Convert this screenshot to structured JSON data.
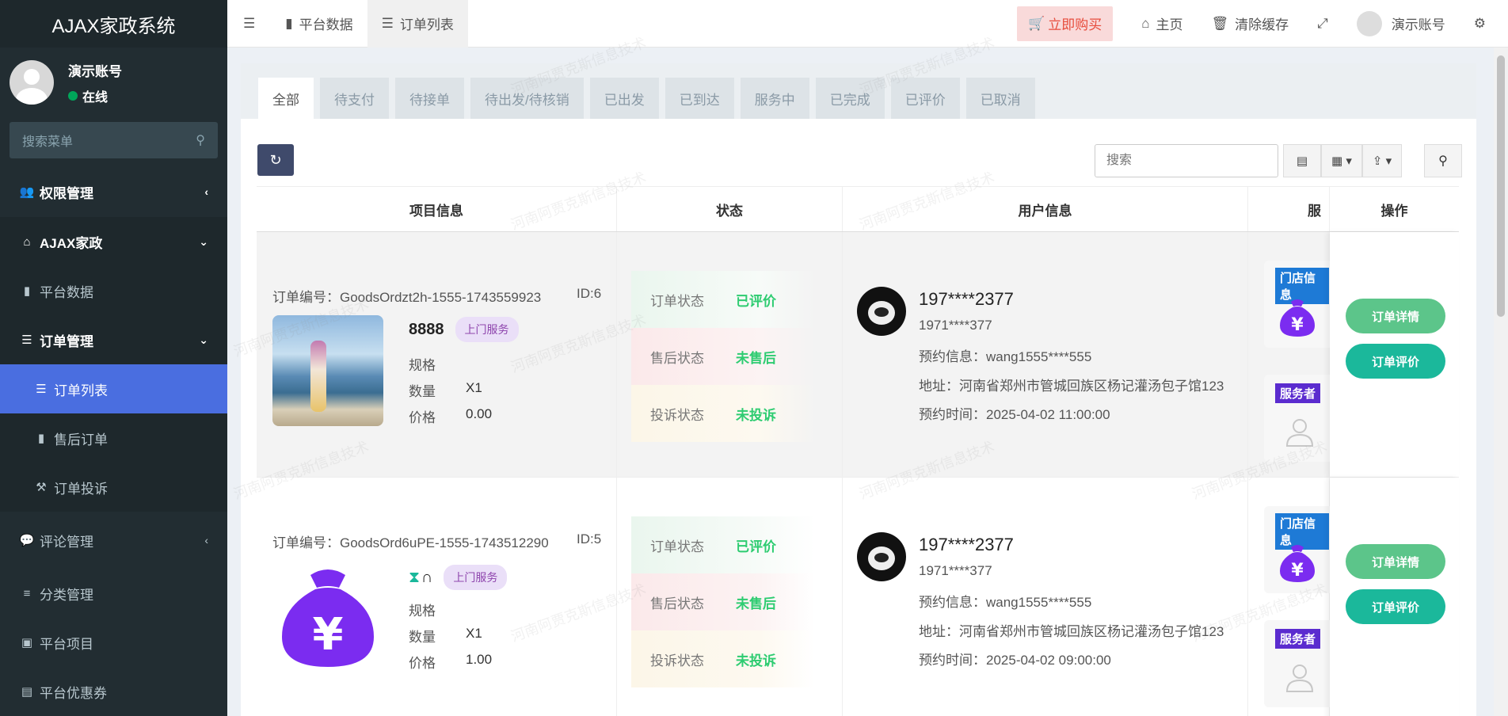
{
  "app": {
    "title": "AJAX家政系统"
  },
  "user": {
    "name": "演示账号",
    "status": "在线"
  },
  "sidebar": {
    "search_placeholder": "搜索菜单",
    "items": [
      {
        "label": "权限管理",
        "icon": "users-icon"
      },
      {
        "label": "AJAX家政",
        "icon": "home-icon"
      },
      {
        "label": "平台数据",
        "icon": "bar-chart-icon"
      },
      {
        "label": "订单管理",
        "icon": "list-icon"
      },
      {
        "label": "订单列表",
        "icon": "list-icon"
      },
      {
        "label": "售后订单",
        "icon": "columns-icon"
      },
      {
        "label": "订单投诉",
        "icon": "gavel-icon"
      },
      {
        "label": "评论管理",
        "icon": "comments-icon"
      },
      {
        "label": "分类管理",
        "icon": "sliders-icon"
      },
      {
        "label": "平台项目",
        "icon": "briefcase-icon"
      },
      {
        "label": "平台优惠券",
        "icon": "credit-card-icon"
      }
    ]
  },
  "topbar": {
    "tabs": [
      {
        "label": "平台数据"
      },
      {
        "label": "订单列表"
      }
    ],
    "buy_label": "立即购买",
    "home_label": "主页",
    "clear_cache_label": "清除缓存",
    "account_label": "演示账号"
  },
  "filter_tabs": [
    "全部",
    "待支付",
    "待接单",
    "待出发/待核销",
    "已出发",
    "已到达",
    "服务中",
    "已完成",
    "已评价",
    "已取消"
  ],
  "toolbar": {
    "search_placeholder": "搜索"
  },
  "table": {
    "headers": [
      "项目信息",
      "状态",
      "用户信息",
      "服",
      "操作"
    ],
    "labels": {
      "order_no": "订单编号：",
      "spec": "规格",
      "qty": "数量",
      "price": "价格",
      "order_status": "订单状态",
      "after_sale_status": "售后状态",
      "complaint_status": "投诉状态",
      "booking_info": "预约信息：",
      "address": "地址：",
      "booking_time": "预约时间：",
      "store_badge": "门店信息",
      "provider_badge": "服务者",
      "detail_btn": "订单详情",
      "review_btn": "订单评价"
    },
    "rows": [
      {
        "order_no": "GoodsOrdzt2h-1555-1743559923",
        "id": "ID:6",
        "name": "8888",
        "service_type": "上门服务",
        "spec": "",
        "qty": "X1",
        "price": "0.00",
        "order_status": "已评价",
        "after_sale_status": "未售后",
        "complaint_status": "未投诉",
        "phone": "197****2377",
        "nickname": "1971****377",
        "booking_info": "wang1555****555",
        "address": "河南省郑州市管城回族区杨记灌汤包子馆123",
        "booking_time": "2025-04-02 11:00:00",
        "thumb": "sea-photo"
      },
      {
        "order_no": "GoodsOrd6uPE-1555-1743512290",
        "id": "ID:5",
        "name": "∩",
        "service_type": "上门服务",
        "spec": "",
        "qty": "X1",
        "price": "1.00",
        "order_status": "已评价",
        "after_sale_status": "未售后",
        "complaint_status": "未投诉",
        "phone": "197****2377",
        "nickname": "1971****377",
        "booking_info": "wang1555****555",
        "address": "河南省郑州市管城回族区杨记灌汤包子馆123",
        "booking_time": "2025-04-02 09:00:00",
        "thumb": "money-bag-icon"
      }
    ]
  },
  "watermark": "河南阿贾克斯信息技术",
  "colors": {
    "sidebar_bg": "#222d32",
    "active_menu": "#4a6ee0",
    "status_green": "#2ecc71",
    "store_badge": "#1e7ad6",
    "provider_badge": "#5b2ccf",
    "bag_purple": "#7b2cf0"
  }
}
